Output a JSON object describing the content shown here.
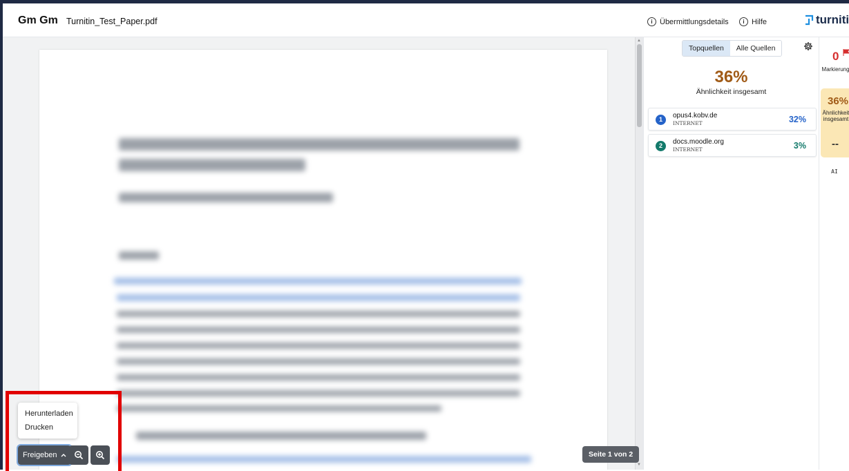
{
  "header": {
    "user_initials": "Gm Gm",
    "document_title": "Turnitin_Test_Paper.pdf",
    "submission_details_label": "Übermittlungsdetails",
    "help_label": "Hilfe",
    "brand_name": "turnitin"
  },
  "viewer": {
    "page_indicator": "Seite 1 von 2",
    "share_button_label": "Freigeben",
    "share_menu": [
      "Herunterladen",
      "Drucken"
    ]
  },
  "panel": {
    "tabs": [
      {
        "label": "Topquellen",
        "active": true
      },
      {
        "label": "Alle Quellen",
        "active": false
      }
    ],
    "overall_score": "36%",
    "overall_label": "Ähnlichkeit insgesamt",
    "sources": [
      {
        "num": "1",
        "name": "opus4.kobv.de",
        "type": "INTERNET",
        "percent": "32%",
        "color": "#2563c9"
      },
      {
        "num": "2",
        "name": "docs.moodle.org",
        "type": "INTERNET",
        "percent": "3%",
        "color": "#137a6b"
      }
    ]
  },
  "rail": {
    "flags_count": "0",
    "flags_label": "Markierungen",
    "similarity_pct": "36%",
    "similarity_label": "Ähnlichkeit insgesamt",
    "ai_value": "--",
    "ai_label": "AI"
  },
  "colors": {
    "score": "#a05a16",
    "highlight_box": "#e10000",
    "similarity_card": "#fbe7b5"
  }
}
